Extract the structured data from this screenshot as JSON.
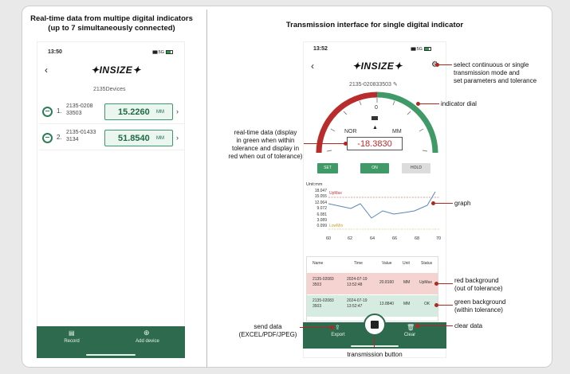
{
  "left_panel": {
    "heading_line1": "Real-time data from multipe digital indicators",
    "heading_line2": "(up to 7 simultaneously connected)",
    "status_time": "13:50",
    "status_right": "5G",
    "logo": "INSIZE",
    "devices_count_label": "2135Devices",
    "devices": [
      {
        "index": "1.",
        "id_line1": "2135-0208",
        "id_line2": "33503",
        "value": "15.2260",
        "unit": "MM"
      },
      {
        "index": "2.",
        "id_line1": "2135-01433",
        "id_line2": "3134",
        "value": "51.8540",
        "unit": "MM"
      }
    ],
    "toolbar": {
      "record_label": "Record",
      "add_device_label": "Add device"
    }
  },
  "right_panel": {
    "heading": "Transmission interface for single digital indicator",
    "status_time": "13:52",
    "status_right": "5G",
    "logo": "INSIZE",
    "device_id": "2135-020833503",
    "dial": {
      "mode_label": "NOR",
      "unit": "MM",
      "zero": "0",
      "reading": "-18.3830"
    },
    "buttons": {
      "set": "SET",
      "on": "ON",
      "hold": "HOLD"
    },
    "graph": {
      "unit_label": "Unit:mm",
      "upmax_label": "UpMax",
      "lowmin_label": "LowMin",
      "y_ticks": [
        "18.047",
        "15.055",
        "12.064",
        "9.072",
        "6.081",
        "3.089",
        "0.099"
      ],
      "x_ticks": [
        "60",
        "62",
        "64",
        "66",
        "68",
        "70"
      ]
    },
    "table": {
      "headers": [
        "Name",
        "Time",
        "Value",
        "Unit",
        "Status"
      ],
      "rows": [
        {
          "name1": "2135-02083",
          "name2": "3503",
          "time1": "2024-07-19",
          "time2": "13:52:48",
          "value": "20.8160",
          "unit": "MM",
          "status": "UpMax"
        },
        {
          "name1": "2135-02083",
          "name2": "3503",
          "time1": "2024-07-19",
          "time2": "13:52:47",
          "value": "13.8840",
          "unit": "MM",
          "status": "OK"
        }
      ]
    },
    "toolbar": {
      "export_label": "Export",
      "clear_label": "Clear"
    },
    "annotations": {
      "settings": [
        "select continuous or single",
        "transmission mode and",
        "set parameters and tolerance"
      ],
      "dial": "indicator dial",
      "realtime": [
        "real-time data (display",
        "in green when within",
        "tolerance and display in",
        "red when out of tolerance)"
      ],
      "graph": "graph",
      "red_bg": [
        "red background",
        "(out of tolerance)"
      ],
      "green_bg": [
        "green background",
        "(within tolerance)"
      ],
      "send": [
        "send data",
        "(EXCEL/PDF/JPEG)"
      ],
      "clear": "clear data",
      "transmission": "transmission button"
    }
  },
  "colors": {
    "brand_green": "#2e6b4e",
    "dial_red": "#b82c2c",
    "dial_green": "#3f9a68",
    "annotation_red": "#b0281e"
  }
}
